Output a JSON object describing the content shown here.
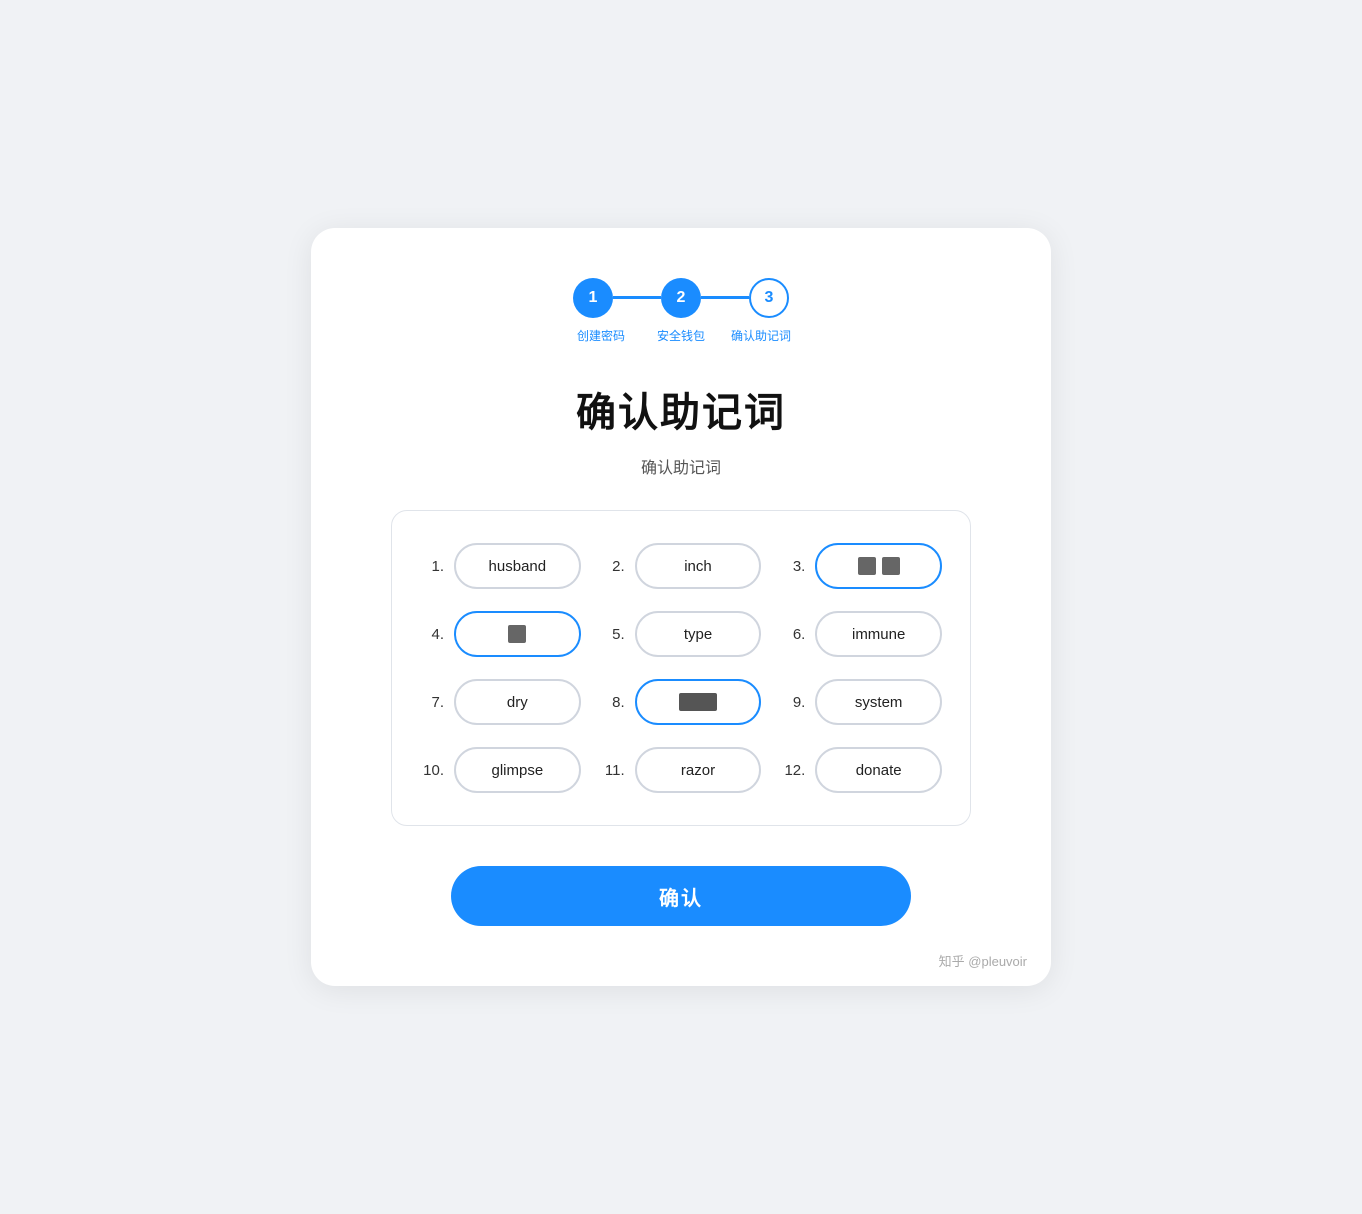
{
  "stepper": {
    "steps": [
      {
        "number": "1",
        "label": "创建密码",
        "state": "active"
      },
      {
        "number": "2",
        "label": "安全钱包",
        "state": "active"
      },
      {
        "number": "3",
        "label": "确认助记词",
        "state": "outline"
      }
    ]
  },
  "main_title": "确认助记词",
  "sub_title": "确认助记词",
  "mnemonic_words": [
    {
      "index": "1.",
      "word": "husband",
      "state": "normal"
    },
    {
      "index": "2.",
      "word": "inch",
      "state": "normal"
    },
    {
      "index": "3.",
      "word": "[blurred_two]",
      "state": "selected"
    },
    {
      "index": "4.",
      "word": "[blurred_one]",
      "state": "selected"
    },
    {
      "index": "5.",
      "word": "type",
      "state": "normal"
    },
    {
      "index": "6.",
      "word": "immune",
      "state": "normal"
    },
    {
      "index": "7.",
      "word": "dry",
      "state": "normal"
    },
    {
      "index": "8.",
      "word": "[blurred_wide]",
      "state": "selected"
    },
    {
      "index": "9.",
      "word": "system",
      "state": "normal"
    },
    {
      "index": "10.",
      "word": "glimpse",
      "state": "normal"
    },
    {
      "index": "11.",
      "word": "razor",
      "state": "normal"
    },
    {
      "index": "12.",
      "word": "donate",
      "state": "normal"
    }
  ],
  "confirm_button": "确认",
  "watermark": "知乎 @pleuvoir"
}
